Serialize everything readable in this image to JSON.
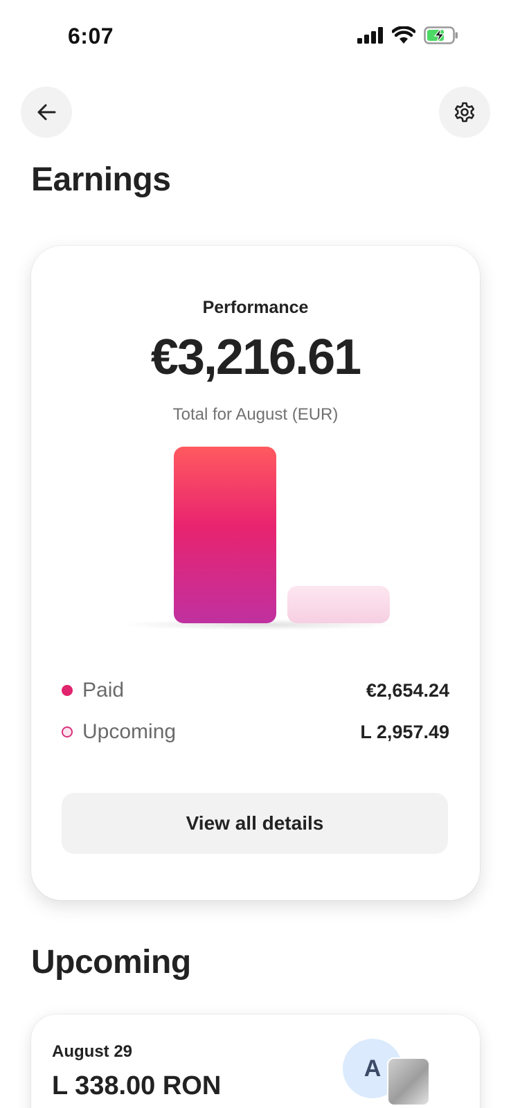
{
  "status_bar": {
    "time": "6:07",
    "icons": [
      "signal-icon",
      "wifi-icon",
      "battery-charging-icon"
    ]
  },
  "header": {
    "back_icon": "arrow-left-icon",
    "settings_icon": "gear-icon",
    "title": "Earnings"
  },
  "performance": {
    "label": "Performance",
    "total": "€3,216.61",
    "caption": "Total for August (EUR)"
  },
  "chart_data": {
    "type": "bar",
    "categories": [
      "Paid",
      "Upcoming"
    ],
    "values": [
      2654.24,
      562.37
    ],
    "colors": [
      "#e0246d",
      "#fbdbe9"
    ]
  },
  "legend": [
    {
      "label": "Paid",
      "value": "€2,654.24",
      "color": "#e0246d"
    },
    {
      "label": "Upcoming",
      "value": "L 2,957.49",
      "color": "#fbe4ef"
    }
  ],
  "details_button": "View all details",
  "upcoming_section": {
    "title": "Upcoming",
    "item": {
      "date": "August 29",
      "amount": "L 338.00 RON",
      "avatar_initial": "A"
    }
  }
}
